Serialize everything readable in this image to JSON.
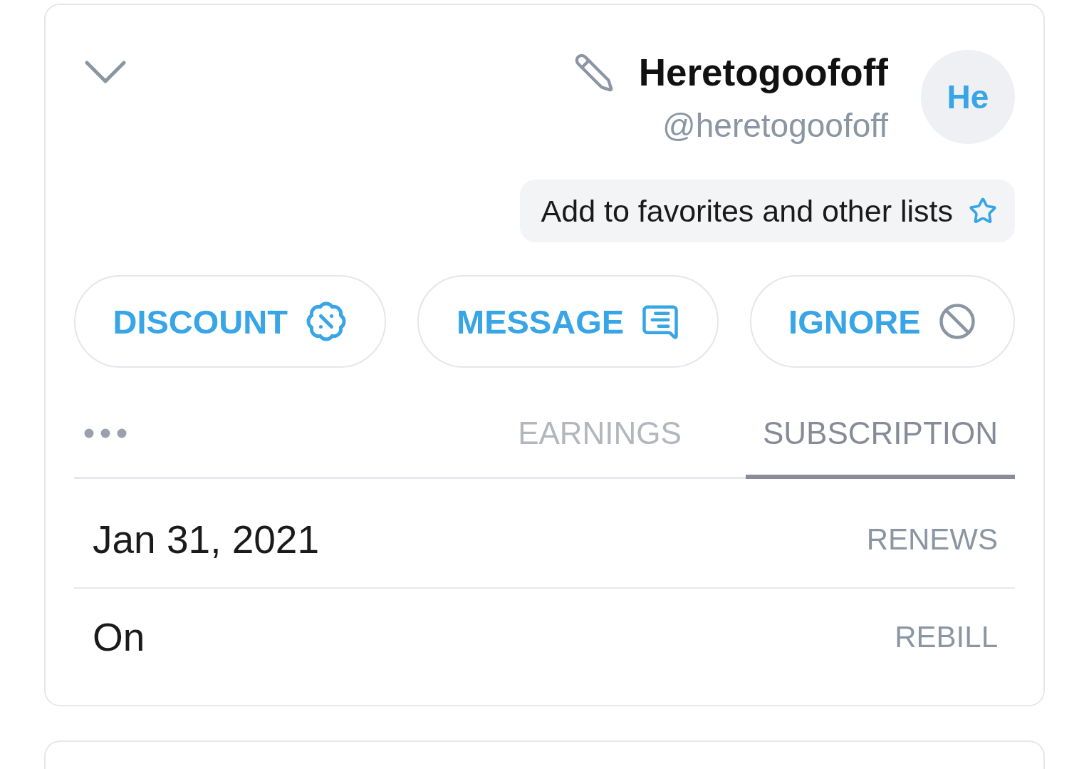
{
  "profile": {
    "avatar_initials": "He",
    "display_name": "Heretogoofoff",
    "handle": "@heretogoofoff",
    "favorites_button": "Add to favorites and other lists"
  },
  "actions": [
    {
      "kind": "discount",
      "label": "DISCOUNT"
    },
    {
      "kind": "message",
      "label": "MESSAGE"
    },
    {
      "kind": "ignore",
      "label": "IGNORE"
    }
  ],
  "tabs": [
    {
      "label": "EARNINGS",
      "selected": false
    },
    {
      "label": "SUBSCRIPTION",
      "selected": true
    }
  ],
  "details": [
    {
      "label": "RENEWS",
      "value": "Jan 31, 2021"
    },
    {
      "label": "REBILL",
      "value": "On"
    }
  ]
}
